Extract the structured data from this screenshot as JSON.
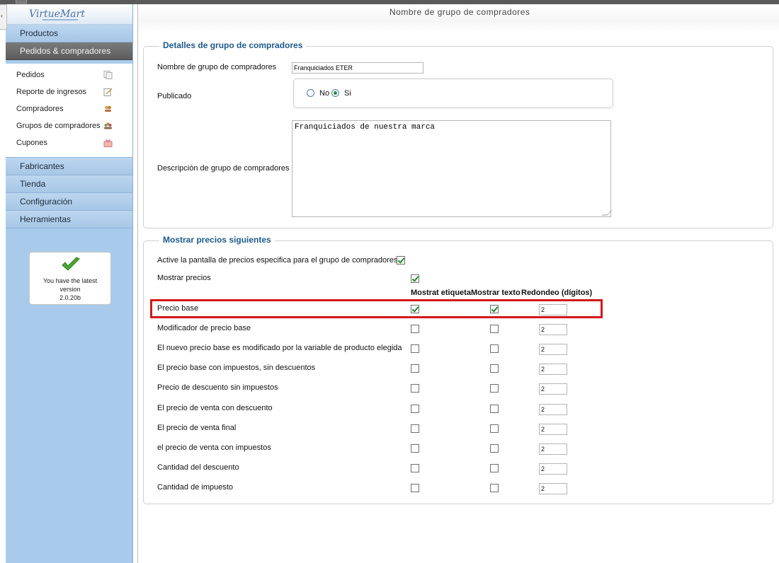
{
  "sidebar": {
    "logo": "VirtueMart",
    "menu": [
      {
        "label": "Productos"
      },
      {
        "label": "Pedidos & compradores"
      },
      {
        "label": "Fabricantes"
      },
      {
        "label": "Tienda"
      },
      {
        "label": "Configuración"
      },
      {
        "label": "Herramientas"
      }
    ],
    "subitems": [
      {
        "label": "Pedidos",
        "icon": "pages-icon"
      },
      {
        "label": "Reporte de ingresos",
        "icon": "report-icon"
      },
      {
        "label": "Compradores",
        "icon": "users-icon"
      },
      {
        "label": "Grupos de compradores",
        "icon": "group-icon"
      },
      {
        "label": "Cupones",
        "icon": "gift-icon"
      }
    ],
    "update": {
      "line1": "You have the latest",
      "line2": "version",
      "line3": "2.0.20b"
    }
  },
  "page": {
    "title": "Nombre de grupo de compradores"
  },
  "details": {
    "legend": "Detalles de grupo de compradores",
    "name_label": "Nombre de grupo de compradores",
    "name_value": "Franquiciados ETER",
    "published_label": "Publicado",
    "radio_no": "No",
    "radio_si": "Si",
    "published": "Si",
    "desc_label": "Descripción de grupo de compradores",
    "desc_value": "Franquiciados de nuestra marca"
  },
  "prices": {
    "legend": "Mostrar precios siguientes",
    "activate_label": "Active la pantalla de precios especifica para el grupo de compradores",
    "activate_checked": true,
    "show_label": "Mostrar precios",
    "show_checked": true,
    "col_label": "Mostrat etiqueta",
    "col_text": "Mostrar texto",
    "col_round": "Redondeo (dígitos)",
    "rows": [
      {
        "label": "Precio base",
        "etiqueta": true,
        "texto": true,
        "redondeo": "2"
      },
      {
        "label": "Modificador de precio base",
        "etiqueta": false,
        "texto": false,
        "redondeo": "2"
      },
      {
        "label": "El nuevo precio base es modificado por la variable de producto elegida",
        "etiqueta": false,
        "texto": false,
        "redondeo": "2"
      },
      {
        "label": "El precio base con impuestos, sin descuentos",
        "etiqueta": false,
        "texto": false,
        "redondeo": "2"
      },
      {
        "label": "Precio de descuento sin impuestos",
        "etiqueta": false,
        "texto": false,
        "redondeo": "2"
      },
      {
        "label": "El precio de venta con descuento",
        "etiqueta": false,
        "texto": false,
        "redondeo": "2"
      },
      {
        "label": "El precio de venta final",
        "etiqueta": false,
        "texto": false,
        "redondeo": "2"
      },
      {
        "label": "el precio de venta con impuestos",
        "etiqueta": false,
        "texto": false,
        "redondeo": "2"
      },
      {
        "label": "Cantidad del descuento",
        "etiqueta": false,
        "texto": false,
        "redondeo": "2"
      },
      {
        "label": "Cantidad de impuesto",
        "etiqueta": false,
        "texto": false,
        "redondeo": "2"
      }
    ]
  },
  "colors": {
    "accent": "#1e5a8a",
    "highlight": "#d3171b",
    "sidebar": "#a9cbeb",
    "active_menu": "#656565"
  }
}
